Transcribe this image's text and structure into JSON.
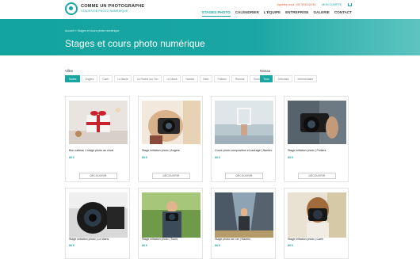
{
  "header": {
    "logo_name": "COMME UN PHOTOGRAPHE",
    "logo_tagline": "STAGES DE PHOTO NUMÉRIQUE",
    "call_text": "Appelez nous : 06 78 54 04 54",
    "account_label": "MON COMPTE",
    "nav": [
      "STAGES PHOTO",
      "CALENDRIER",
      "L'ÉQUIPE",
      "ENTREPRISE",
      "GALERIE",
      "CONTACT"
    ]
  },
  "hero": {
    "breadcrumb": "Accueil » Stages et cours photo numérique",
    "title": "Stages et cours photo numérique"
  },
  "filters": {
    "cities_label": "Villes",
    "cities": [
      "Toutes",
      "Angers",
      "Caen",
      "La Baule",
      "La Roche sur Yon",
      "Le Mans",
      "Nantes",
      "Niort",
      "Poitiers",
      "Rennes",
      "Tours"
    ],
    "level_label": "Niveau",
    "levels": [
      "Tous",
      "Débutant",
      "Intermédiaire"
    ]
  },
  "cards": [
    {
      "title": "Bon cadeau 1 stage photo au choix",
      "price": "80 €",
      "button": "DÉCOUVRIR"
    },
    {
      "title": "Stage initiation photo | Angers",
      "price": "80 €",
      "button": "DÉCOUVRIR"
    },
    {
      "title": "Cours photo composition et cadrage | Nantes",
      "price": "80 €",
      "button": "DÉCOUVRIR"
    },
    {
      "title": "Stage initiation photo | Poitiers",
      "price": "80 €",
      "button": "DÉCOUVRIR"
    },
    {
      "title": "Stage initiation photo | Le Mans",
      "price": "80 €",
      "button": ""
    },
    {
      "title": "Stage initiation photo | Tours",
      "price": "80 €",
      "button": ""
    },
    {
      "title": "Stage photo de rue | Nantes",
      "price": "80 €",
      "button": ""
    },
    {
      "title": "Stage initiation photo | Caen",
      "price": "80 €",
      "button": ""
    }
  ],
  "colors": {
    "accent": "#1aa6a3",
    "call": "#e05a2a"
  }
}
